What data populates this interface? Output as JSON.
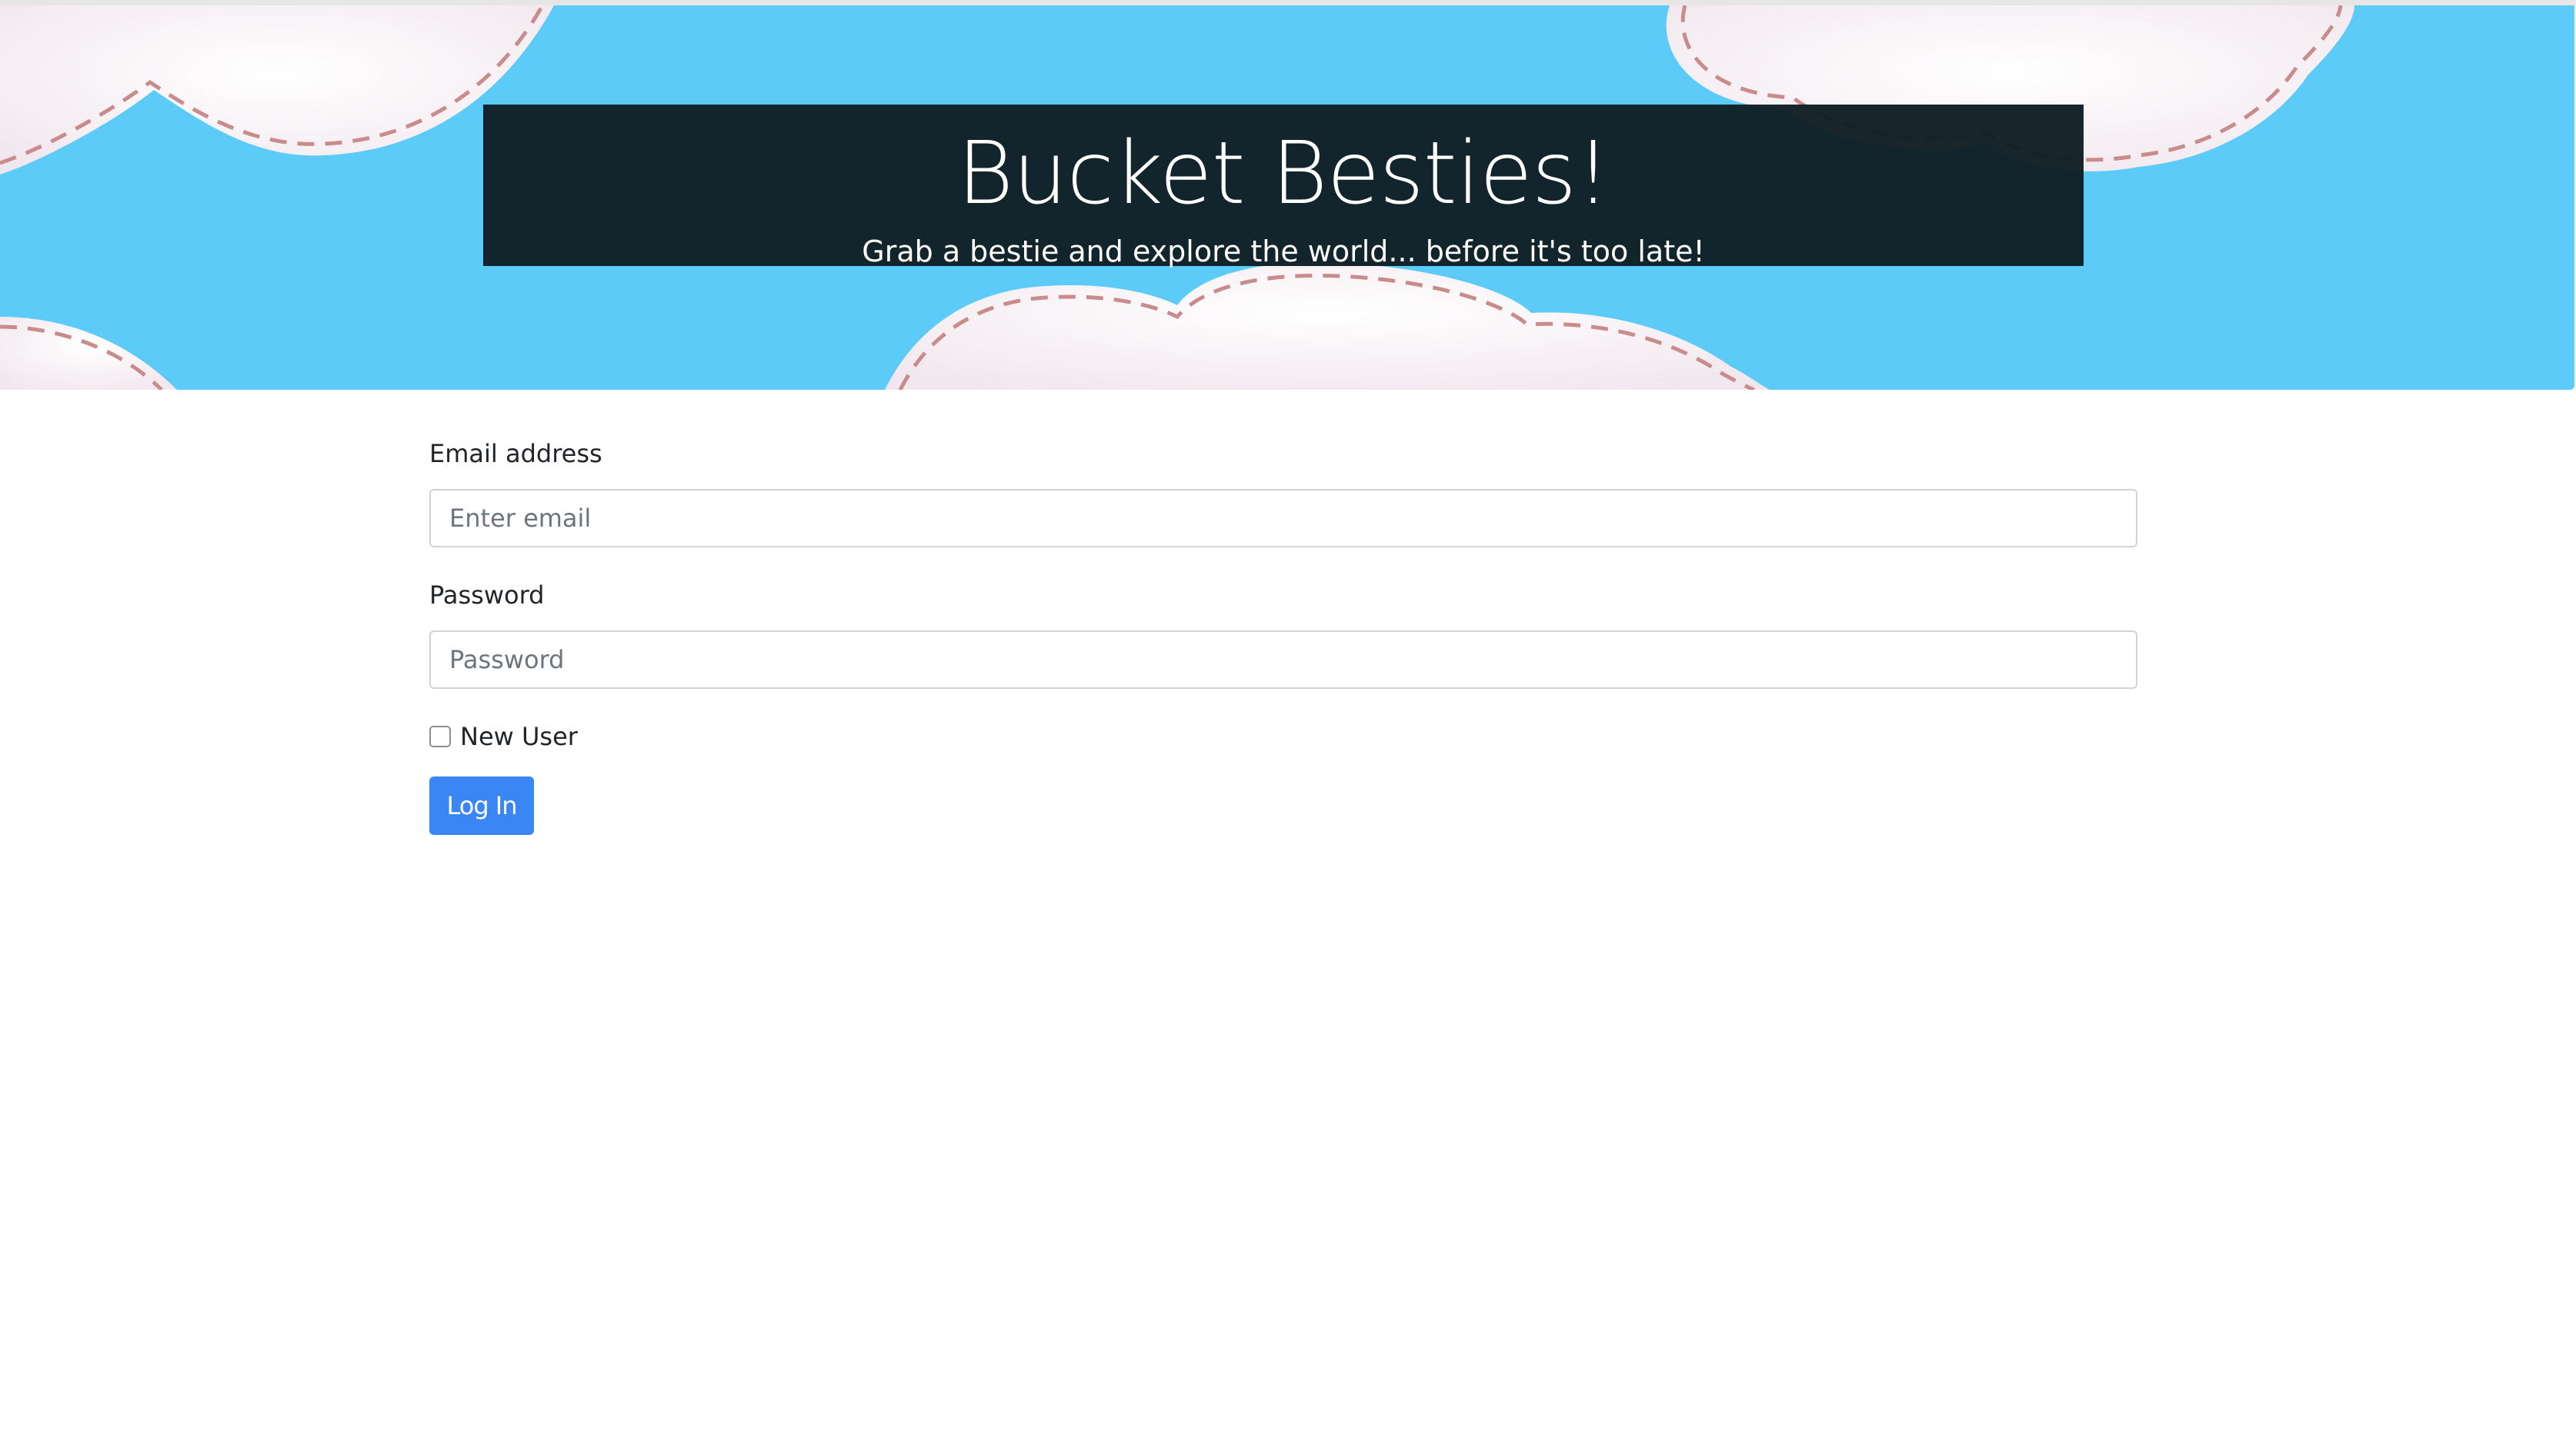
{
  "header": {
    "title": "Bucket Besties!",
    "subtitle": "Grab a bestie and explore the world... before it's too late!",
    "background_color": "#5ccbf7",
    "banner_color": "#111f25"
  },
  "login_form": {
    "email": {
      "label": "Email address",
      "placeholder": "Enter email",
      "value": ""
    },
    "password": {
      "label": "Password",
      "placeholder": "Password",
      "value": ""
    },
    "new_user": {
      "label": "New User",
      "checked": false
    },
    "submit_label": "Log In",
    "submit_color": "#3a86f5"
  }
}
